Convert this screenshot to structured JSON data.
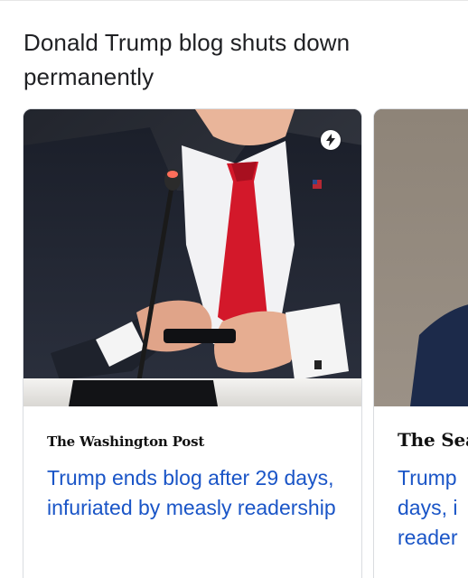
{
  "headline": "Donald Trump blog shuts down permanently",
  "cards": [
    {
      "source": "The Washington Post",
      "title": "Trump ends blog after 29 days, infuriated by measly readership",
      "badge_icon": "amp-lightning-icon"
    },
    {
      "source": "The Seat",
      "title_lines": [
        "Trump",
        "days, i",
        "reader"
      ]
    }
  ],
  "colors": {
    "headline": "#202124",
    "link": "#1a55c7",
    "border": "#dadce0"
  }
}
